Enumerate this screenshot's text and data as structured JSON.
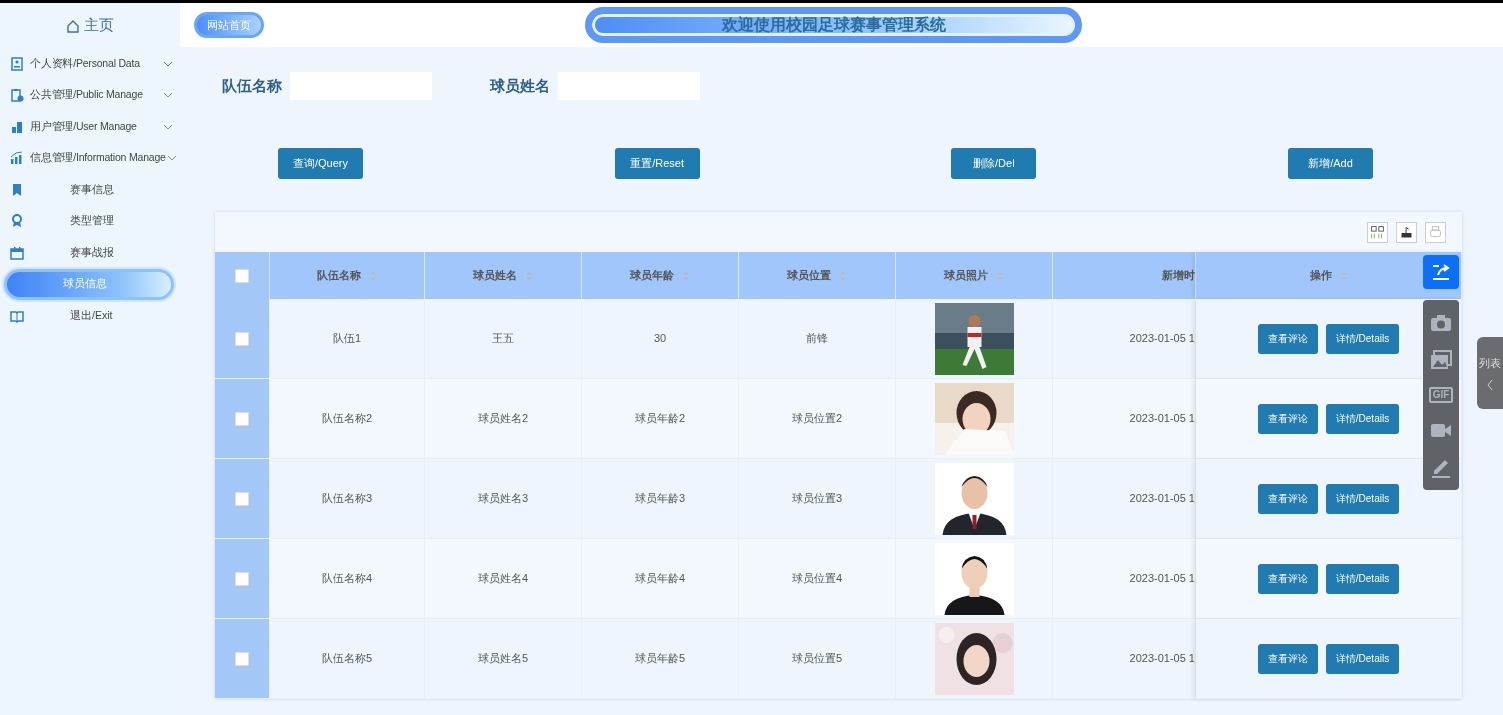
{
  "sidebar": {
    "home": "主页",
    "items": [
      {
        "label": "个人资料/Personal Data",
        "kind": "group",
        "expanded": false,
        "selected": false
      },
      {
        "label": "公共管理/Public Manage",
        "kind": "group",
        "expanded": false,
        "selected": false
      },
      {
        "label": "用户管理/User Manage",
        "kind": "group",
        "expanded": false,
        "selected": false
      },
      {
        "label": "信息管理/Information Manage",
        "kind": "group",
        "expanded": false,
        "selected": false
      },
      {
        "label": "赛事信息",
        "kind": "link",
        "selected": false
      },
      {
        "label": "类型管理",
        "kind": "link",
        "selected": false
      },
      {
        "label": "赛事战报",
        "kind": "link",
        "selected": false
      },
      {
        "label": "球员信息",
        "kind": "link",
        "selected": true
      },
      {
        "label": "退出/Exit",
        "kind": "link",
        "selected": false
      }
    ]
  },
  "header": {
    "home_link": "网站首页",
    "title": "欢迎使用校园足球赛事管理系统"
  },
  "search": {
    "fields": [
      {
        "label": "队伍名称"
      },
      {
        "label": "球员姓名"
      }
    ],
    "buttons": [
      "查询/Query",
      "重置/Reset",
      "删除/Del",
      "新增/Add"
    ]
  },
  "table": {
    "select_all": {
      "checked": false
    },
    "columns": [
      {
        "label": "队伍名称",
        "sortable": true
      },
      {
        "label": "球员姓名",
        "sortable": true
      },
      {
        "label": "球员年龄",
        "sortable": true
      },
      {
        "label": "球员位置",
        "sortable": true
      },
      {
        "label": "球员照片",
        "sortable": true
      },
      {
        "label": "新增时",
        "sortable": false
      },
      {
        "label": "操作",
        "sortable": true
      }
    ],
    "rows": [
      {
        "checked": false,
        "cells": [
          "队伍1",
          "王五",
          "30",
          "前锋"
        ],
        "photo": {
          "kind": "picture"
        },
        "time": "2023-01-05 1",
        "actions": [
          "查看评论",
          "详情/Details"
        ]
      },
      {
        "checked": false,
        "cells": [
          "队伍名称2",
          "球员姓名2",
          "球员年龄2",
          "球员位置2"
        ],
        "photo": {
          "kind": "picture"
        },
        "time": "2023-01-05 1",
        "actions": [
          "查看评论",
          "详情/Details"
        ]
      },
      {
        "checked": false,
        "cells": [
          "队伍名称3",
          "球员姓名3",
          "球员年龄3",
          "球员位置3"
        ],
        "photo": {
          "kind": "picture"
        },
        "time": "2023-01-05 1",
        "actions": [
          "查看评论",
          "详情/Details"
        ]
      },
      {
        "checked": false,
        "cells": [
          "队伍名称4",
          "球员姓名4",
          "球员年龄4",
          "球员位置4"
        ],
        "photo": {
          "kind": "picture"
        },
        "time": "2023-01-05 1",
        "actions": [
          "查看评论",
          "详情/Details"
        ]
      },
      {
        "checked": false,
        "cells": [
          "队伍名称5",
          "球员姓名5",
          "球员年龄5",
          "球员位置5"
        ],
        "photo": {
          "kind": "picture"
        },
        "time": "2023-01-05 1",
        "actions": [
          "查看评论",
          "详情/Details"
        ]
      }
    ]
  },
  "capture_toolbar": {
    "gif_label": "GIF"
  },
  "side_tab": {
    "label": "列表"
  }
}
